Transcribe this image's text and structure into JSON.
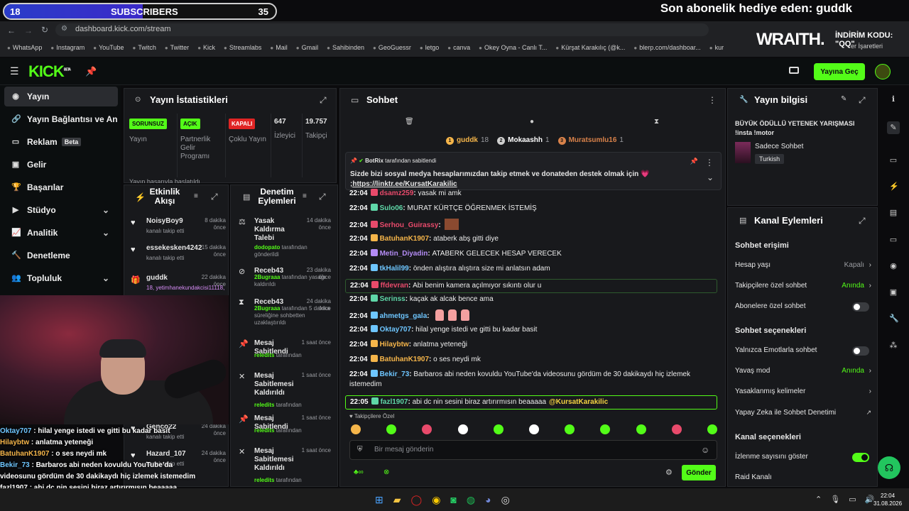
{
  "overlay": {
    "subscribers": {
      "current": "18",
      "label": "SUBSCRIBERS",
      "goal": "35",
      "progress_fraction": 0.51
    },
    "gift_title": "Son abonelik hediye eden: guddk",
    "sponsor_logo": "WRAITH.",
    "promo_line1": "İNDİRİM KODU:",
    "promo_line2": "\"QQ\""
  },
  "browser": {
    "url": "dashboard.kick.com/stream",
    "bookmarks": [
      "WhatsApp",
      "Instagram",
      "YouTube",
      "Twitch",
      "Twitter",
      "Kick",
      "Streamlabs",
      "Mail",
      "Gmail",
      "Sahibinden",
      "GeoGuessr",
      "letgo",
      "canva",
      "Okey Oyna - Canlı T...",
      "Kürşat Karakılıç (@k...",
      "blerp.com/dashboar...",
      "kur"
    ],
    "other_bookmarks": "er İşaretleri"
  },
  "header": {
    "logo": "KICK",
    "logo_sup": "BETA",
    "go_live": "Yayına Geç"
  },
  "sidebar": {
    "items": [
      {
        "label": "Yayın"
      },
      {
        "label": "Yayın Bağlantısı ve Anahtar"
      },
      {
        "label": "Reklam",
        "badge": "Beta"
      },
      {
        "label": "Gelir"
      },
      {
        "label": "Başarılar"
      },
      {
        "label": "Stüdyo"
      },
      {
        "label": "Analitik"
      },
      {
        "label": "Denetleme"
      },
      {
        "label": "Topluluk"
      }
    ]
  },
  "stats": {
    "title": "Yayın İstatistikleri",
    "cards": [
      {
        "badge": "SORUNSUZ",
        "label": "Yayın",
        "color": "#53fc18"
      },
      {
        "badge": "AÇIK",
        "label": "Partnerlik Gelir Programı",
        "color": "#53fc18"
      },
      {
        "badge": "KAPALI",
        "label": "Çoklu Yayın",
        "color": "#e02424"
      },
      {
        "value": "647",
        "label": "İzleyici"
      },
      {
        "value": "19.757",
        "label": "Takipçi"
      }
    ],
    "footer": "Yayın başarıyla başlatıldı"
  },
  "activity": {
    "title": "Etkinlik Akışı",
    "items": [
      {
        "name": "NoisyBoy9",
        "time": "8 dakika önce",
        "desc": "kanalı takip etti"
      },
      {
        "name": "essekesken4242",
        "time": "15 dakika önce",
        "desc": "kanalı takip etti"
      },
      {
        "name": "guddk",
        "time": "22 dakika önce",
        "desc": "18, yetimhanekundakcisi11118,"
      },
      {
        "name": "Genco22",
        "time": "24 dakika önce",
        "desc": "kanalı takip etti"
      },
      {
        "name": "Hazard_107",
        "time": "24 dakika önce",
        "desc": "kanalı takip etti"
      }
    ]
  },
  "moderation": {
    "title": "Denetim Eylemleri",
    "items": [
      {
        "title": "Yasak Kaldırma Talebi",
        "time": "14 dakika önce",
        "actor": "dodopato",
        "desc": " tarafından gönderildi"
      },
      {
        "title": "Receb43",
        "time": "23 dakika önce",
        "actor": "2Bugraaa",
        "desc": " tarafından yasağı kaldırıldı"
      },
      {
        "title": "Receb43",
        "time": "24 dakika önce",
        "actor": "2Bugraaa",
        "desc": " tarafından 5 dakika süreliğine sohbetten uzaklaştırıldı"
      },
      {
        "title": "Mesaj Sabitlendi",
        "time": "1 saat önce",
        "actor": "reledits",
        "desc": " tarafından"
      },
      {
        "title": "Mesaj Sabitlemesi Kaldırıldı",
        "time": "1 saat önce",
        "actor": "reledits",
        "desc": " tarafından"
      },
      {
        "title": "Mesaj Sabitlendi",
        "time": "1 saat önce",
        "actor": "reledits",
        "desc": " tarafından"
      },
      {
        "title": "Mesaj Sabitlemesi Kaldırıldı",
        "time": "1 saat önce",
        "actor": "reledits",
        "desc": " tarafından"
      }
    ]
  },
  "chat": {
    "title": "Sohbet",
    "top_gifters": [
      {
        "rank": "1",
        "name": "guddk",
        "count": "18"
      },
      {
        "rank": "2",
        "name": "Mokaashh",
        "count": "1"
      },
      {
        "rank": "3",
        "name": "Muratsumlu16",
        "count": "1"
      }
    ],
    "pinned": {
      "by": "BotRix",
      "by_suffix": "tarafından sabitlendi",
      "text": "Sizde bizi sosyal medya hesaplarımızdan takip etmek ve donateden destek olmak için 💗",
      "link": ";https://linktr.ee/KursatKarakilic"
    },
    "messages": [
      {
        "time": "22:04",
        "user": "dsamz259",
        "text": "yasak mi amk",
        "color": "#e84a6b"
      },
      {
        "time": "22:04",
        "user": "Sulo06",
        "text": "MURAT KÜRTÇE ÖĞRENMEK İSTEMİŞ",
        "color": "#5fd7a8"
      },
      {
        "time": "22:04",
        "user": "Serhou_Guirassy",
        "text": "",
        "color": "#e84a6b"
      },
      {
        "time": "22:04",
        "user": "BatuhanK1907",
        "text": "ataberk abş gitti diye",
        "color": "#f5b54a"
      },
      {
        "time": "22:04",
        "user": "Metin_Diyadin",
        "text": "ATABERK GELECEK HESAP VERECEK",
        "color": "#b48cf5"
      },
      {
        "time": "22:04",
        "user": "tkHalil99",
        "text": "önden alıştıra alıştıra size mi anlatsın adam",
        "color": "#6ec6ff"
      },
      {
        "time": "22:04",
        "user": "ffdevran",
        "text": "Abi benim kamera açılmıyor sıkıntı olur u",
        "color": "#e84a6b"
      },
      {
        "time": "22:04",
        "user": "Serinss",
        "text": "kaçak ak alcak bence ama",
        "color": "#5fd7a8"
      },
      {
        "time": "22:04",
        "user": "ahmetgs_gala",
        "text": "",
        "color": "#6ec6ff"
      },
      {
        "time": "22:04",
        "user": "Oktay707",
        "text": "hilal yenge istedi ve gitti bu kadar basit",
        "color": "#6ec6ff"
      },
      {
        "time": "22:04",
        "user": "Hilaybtw",
        "text": "anlatma yeteneği",
        "color": "#f5b54a"
      },
      {
        "time": "22:04",
        "user": "BatuhanK1907",
        "text": "o ses neydi mk",
        "color": "#f5b54a"
      },
      {
        "time": "22:04",
        "user": "Bekir_73",
        "text": "Barbaros abi neden kovuldu YouTube'da videosunu gördüm de 30 dakikaydı hiç izlemek istemedim",
        "color": "#6ec6ff"
      },
      {
        "time": "22:05",
        "user": "fazl1907",
        "text": "abi dc nin sesini biraz artırırmısın beaaaaa",
        "mention": "@KursatKarakilic",
        "color": "#5fd7a8"
      }
    ],
    "followers_only": "Takipçilere Özel",
    "input_placeholder": "Bir mesaj gönderin",
    "send": "Gönder"
  },
  "stream_info": {
    "title": "Yayın bilgisi",
    "stream_title": "BÜYÜK ÖDÜLLÜ YETENEK YARIŞMASI !insta !motor",
    "category": "Sadece Sohbet",
    "tag": "Turkish"
  },
  "channel_actions": {
    "title": "Kanal Eylemleri",
    "chat_access": "Sohbet erişimi",
    "account_age": {
      "label": "Hesap yaşı",
      "value": "Kapalı"
    },
    "followers_only": {
      "label": "Takipçilere özel sohbet",
      "value": "Anında"
    },
    "subs_only": {
      "label": "Abonelere özel sohbet"
    },
    "chat_options": "Sohbet seçenekleri",
    "emote_only": {
      "label": "Yalnızca Emotlarla sohbet"
    },
    "slow_mode": {
      "label": "Yavaş mod",
      "value": "Anında"
    },
    "banned_words": {
      "label": "Yasaklanmış kelimeler"
    },
    "ai_mod": {
      "label": "Yapay Zeka ile Sohbet Denetimi"
    },
    "channel_options": "Kanal seçenekleri",
    "show_views": {
      "label": "İzlenme sayısını göster"
    },
    "raid": {
      "label": "Raid Kanalı"
    }
  },
  "overlay_chat": [
    {
      "user": "Oktay707",
      "text": " : hilal yenge istedi ve gitti bu kadar basit",
      "color": "#6ec6ff"
    },
    {
      "user": "Hilaybtw",
      "text": " : anlatma yeteneği",
      "color": "#f5b54a"
    },
    {
      "user": "BatuhanK1907",
      "text": " : o ses neydi mk",
      "color": "#f5b54a"
    },
    {
      "user": "Bekir_73",
      "text": " : Barbaros abi neden kovuldu YouTube'da videosunu gördüm de 30 dakikaydı hiç izlemek istemedim",
      "color": "#6ec6ff"
    },
    {
      "user": "fazl1907",
      "text": " : abi dc nin sesini biraz artırırmısın beaaaaa @KursatKarakilic",
      "color": "#ffffff"
    }
  ],
  "taskbar": {
    "time": "22:04",
    "date": "31.08.2026"
  }
}
